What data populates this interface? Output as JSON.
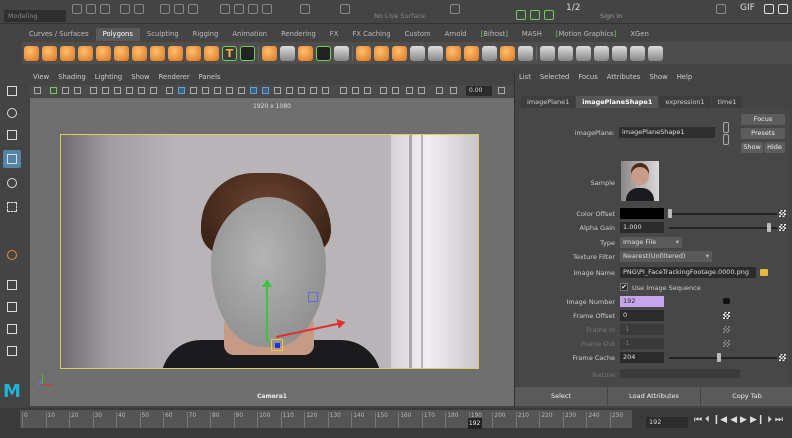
{
  "topbar": {
    "mode": "Modeling",
    "no_live_surface": "No Live Surface",
    "page_indicator": "1/2",
    "sign_in": "Sign In",
    "gif_label": "GIF"
  },
  "shelf": {
    "tabs": [
      "Curves / Surfaces",
      "Polygons",
      "Sculpting",
      "Rigging",
      "Animation",
      "Rendering",
      "FX",
      "FX Caching",
      "Custom",
      "Arnold",
      "Bifrost",
      "MASH",
      "Motion Graphics",
      "XGen"
    ],
    "active_tab": "Polygons",
    "text_tool_glyph": "T"
  },
  "viewport": {
    "menu": [
      "View",
      "Shading",
      "Lighting",
      "Show",
      "Renderer",
      "Panels"
    ],
    "resolution": "1920 x 1080",
    "camera": "Camera1",
    "gamma_value": "0.00"
  },
  "attribute_editor": {
    "menu": [
      "List",
      "Selected",
      "Focus",
      "Attributes",
      "Show",
      "Help"
    ],
    "tabs": [
      "imagePlane1",
      "imagePlaneShape1",
      "expression1",
      "time1"
    ],
    "active_tab": "imagePlaneShape1",
    "node_label": "imagePlane:",
    "node_name": "imagePlaneShape1",
    "focus": "Focus",
    "presets": "Presets",
    "show": "Show",
    "hide": "Hide",
    "sample": "Sample",
    "color_offset_label": "Color Offset",
    "alpha_gain_label": "Alpha Gain",
    "alpha_gain": "1.000",
    "type_label": "Type",
    "type": "Image File",
    "texture_filter_label": "Texture Filter",
    "texture_filter": "Nearest(Unfiltered)",
    "image_name_label": "Image Name",
    "image_name": "PNG\\PI_FaceTrackingFootage.0000.png",
    "use_sequence_label": "Use Image Sequence",
    "use_sequence_checked": "✔",
    "image_number_label": "Image Number",
    "image_number": "192",
    "frame_offset_label": "Frame Offset",
    "frame_offset": "0",
    "frame_in_label": "Frame In",
    "frame_in": "-1",
    "frame_out_label": "Frame Out",
    "frame_out": "-1",
    "frame_cache_label": "Frame Cache",
    "frame_cache": "204",
    "texture_label": "Texture",
    "select": "Select",
    "load_attributes": "Load Attributes",
    "copy_tab": "Copy Tab"
  },
  "timeline": {
    "ticks": [
      "0",
      "10",
      "20",
      "30",
      "40",
      "50",
      "60",
      "70",
      "80",
      "90",
      "100",
      "110",
      "120",
      "130",
      "140",
      "150",
      "160",
      "170",
      "180",
      "190",
      "200",
      "210",
      "220",
      "230",
      "240",
      "250"
    ],
    "current_frame": "192",
    "frame_field": "192",
    "controls": [
      "⏮",
      "⏴",
      "❙◀",
      "◀",
      "▶",
      "▶❙",
      "⏵",
      "⏭"
    ]
  },
  "logo": "M",
  "colors": {
    "selection_blue": "#5285a6",
    "highlight_purple": "#c6a6ec",
    "bracket_green": "#6fcf5a",
    "camera_gate": "#d9cf5f"
  }
}
